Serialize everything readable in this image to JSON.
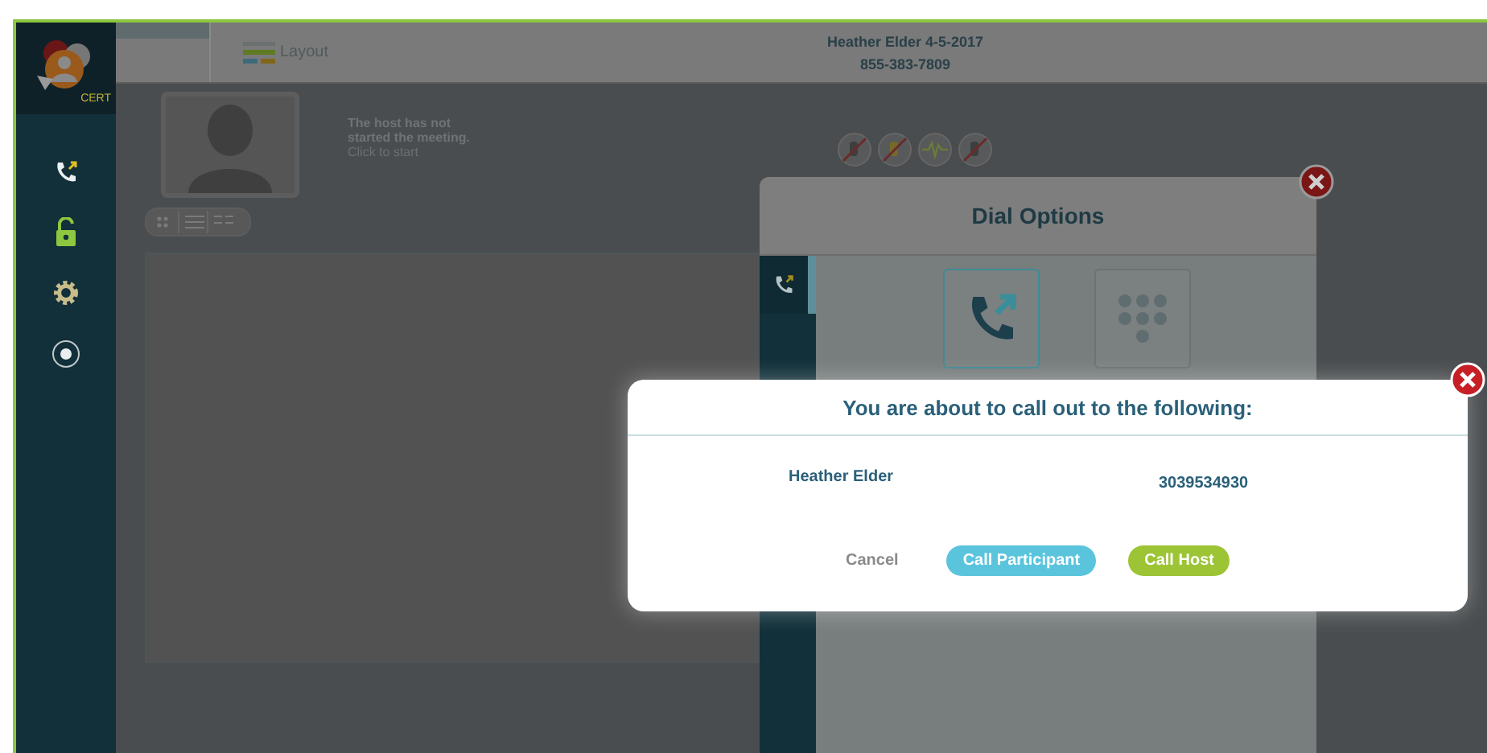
{
  "sidebar": {
    "logo_label": "CERT",
    "items": [
      {
        "kind": "dial"
      },
      {
        "kind": "lock"
      },
      {
        "kind": "settings"
      },
      {
        "kind": "record"
      }
    ]
  },
  "toolbar": {
    "layout_label": "Layout",
    "meeting_title": "Heather Elder 4-5-2017",
    "phone": "855-383-7809"
  },
  "host_status": {
    "message": "The host has not started the meeting.",
    "action": "Click to start"
  },
  "dial_options": {
    "title": "Dial Options"
  },
  "confirm_dialog": {
    "title": "You are about to call out to the following:",
    "name": "Heather Elder",
    "number": "3039534930",
    "buttons": [
      {
        "label": "Cancel",
        "kind": "text"
      },
      {
        "label": "Call Participant",
        "kind": "participant"
      },
      {
        "label": "Call Host",
        "kind": "host"
      }
    ]
  }
}
